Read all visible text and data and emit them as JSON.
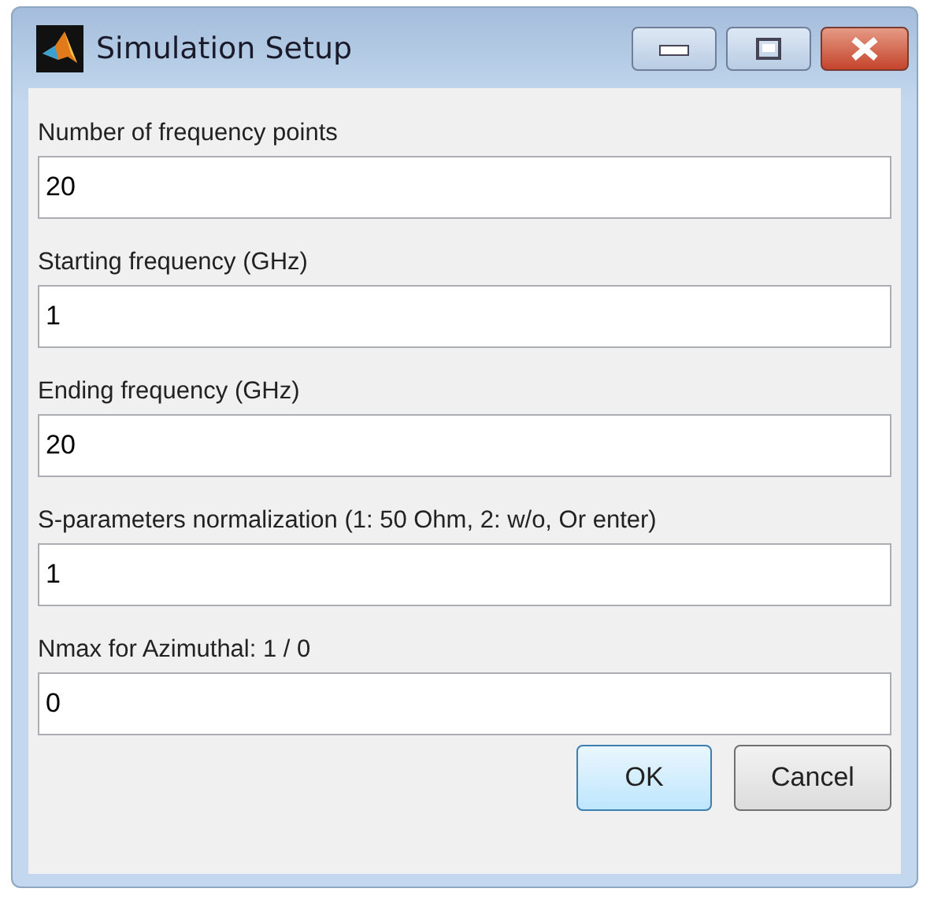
{
  "window": {
    "title": "Simulation Setup"
  },
  "fields": [
    {
      "label": "Number of frequency points",
      "value": "20"
    },
    {
      "label": "Starting frequency (GHz)",
      "value": "1"
    },
    {
      "label": "Ending frequency (GHz)",
      "value": "20"
    },
    {
      "label": "S-parameters normalization (1: 50 Ohm, 2: w/o, Or enter)",
      "value": "1"
    },
    {
      "label": "Nmax for Azimuthal: 1 / 0",
      "value": "0"
    }
  ],
  "buttons": [
    {
      "label": "OK",
      "default": true
    },
    {
      "label": "Cancel",
      "default": false
    }
  ]
}
